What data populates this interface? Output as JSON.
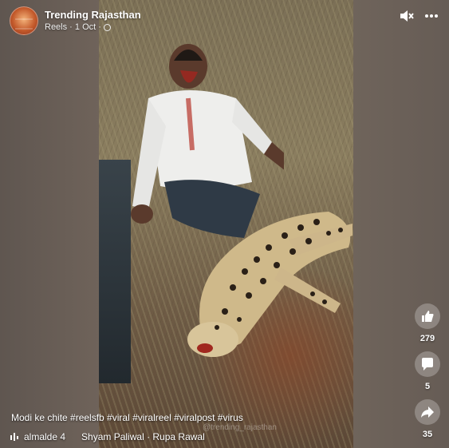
{
  "header": {
    "page_name": "Trending Rajasthan",
    "meta_text": "Reels · 1 Oct ·"
  },
  "icons": {
    "mute": "speaker-muted-icon",
    "more": "more-options-icon",
    "like": "thumbs-up-icon",
    "comment": "comment-bubble-icon",
    "share": "share-arrow-icon",
    "audio": "audio-bars-icon"
  },
  "actions": {
    "likes": "279",
    "comments": "5",
    "shares": "35"
  },
  "caption": "Modi ke chite #reelsfb #viral #viralreel #viralpost #virus",
  "audio": {
    "track_left": "almalde 4",
    "track_right": "Shyam Paliwal · Rupa Rawal"
  },
  "watermark": "@trending_rajasthan",
  "colors": {
    "background": "#6d6158",
    "text": "#ffffff",
    "button_bg": "rgba(255,255,255,0.25)"
  }
}
